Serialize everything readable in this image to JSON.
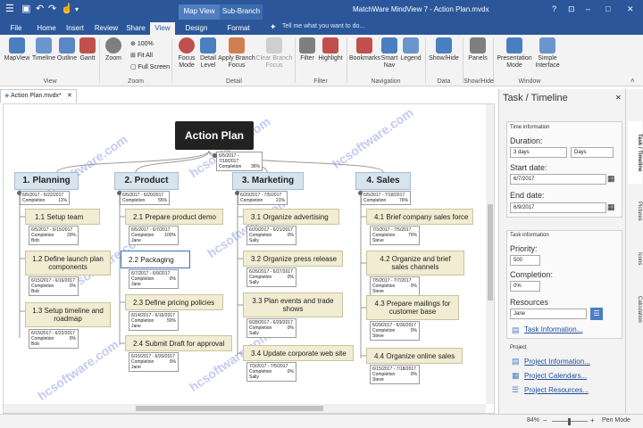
{
  "window": {
    "title": "MatchWare MindView 7 - Action Plan.mvdx",
    "minimize": "–",
    "maximize": "□",
    "close": "✕",
    "help": "?",
    "ribbon_toggle": "⊡"
  },
  "contextual": {
    "map_view": "Map View",
    "sub_branch": "Sub-Branch"
  },
  "menu_tabs": [
    "File",
    "Home",
    "Insert",
    "Review",
    "Share",
    "View",
    "Design",
    "Format"
  ],
  "active_tab": "View",
  "search": {
    "placeholder": "Tell me what you want to do..."
  },
  "ribbon": {
    "buttons": [
      "MapView",
      "Timeline",
      "Outline",
      "Gantt",
      "Zoom",
      "Focus Mode",
      "Detail Level",
      "Apply Branch Focus",
      "Clear Branch Focus",
      "Filter",
      "Highlight",
      "Bookmarks",
      "Smart Nav",
      "Legend",
      "Show/Hide",
      "Panels",
      "Presentation Mode",
      "Simple Interface"
    ],
    "zoom_small": [
      "100%",
      "Fit All",
      "Full Screen"
    ],
    "groups": [
      "View",
      "Zoom",
      "Detail",
      "Filter",
      "Navigation",
      "Data",
      "Show/Hide",
      "Window"
    ],
    "colors": {
      "accent": "#2b579a",
      "icon_blue": "#4a7fc1",
      "icon_red": "#c0504d",
      "icon_gray": "#7f7f7f"
    }
  },
  "doc_tab": {
    "label": "Action Plan.mvdx*",
    "close": "✕"
  },
  "map": {
    "root": {
      "label": "Action Plan",
      "dates": "6/5/2017 - 7/18/2017",
      "completion": "Completion",
      "percent": "36%"
    },
    "branches": [
      {
        "label": "1.  Planning",
        "dates": "6/5/2017 - 6/22/2017",
        "percent": "11%",
        "children": [
          {
            "label": "1.1  Setup team",
            "dates": "6/5/2017 - 6/15/2017",
            "percent": "20%",
            "owner": "Bob"
          },
          {
            "label": "1.2  Define launch plan components",
            "dates": "6/15/2017 - 6/16/2017",
            "percent": "0%",
            "owner": "Bob"
          },
          {
            "label": "1.3  Setup timeline and roadmap",
            "dates": "6/15/2017 - 6/22/2017",
            "percent": "0%",
            "owner": "Bob"
          }
        ]
      },
      {
        "label": "2.  Product",
        "dates": "6/5/2017 - 6/20/2017",
        "percent": "55%",
        "children": [
          {
            "label": "2.1  Prepare product demo",
            "dates": "6/5/2017 - 6/7/2017",
            "percent": "100%",
            "owner": "Jane"
          },
          {
            "label": "2.2  Packaging",
            "dates": "6/7/2017 - 6/9/2017",
            "percent": "0%",
            "owner": "Jane"
          },
          {
            "label": "2.3  Define pricing policies",
            "dates": "6/14/2017 - 6/16/2017",
            "percent": "50%",
            "owner": "Jane"
          },
          {
            "label": "2.4  Submit Draft for approval",
            "dates": "6/16/2017 - 6/20/2017",
            "percent": "0%",
            "owner": "Jane"
          }
        ]
      },
      {
        "label": "3.  Marketing",
        "dates": "6/20/2017 - 7/5/2017",
        "percent": "21%",
        "children": [
          {
            "label": "3.1  Organize advertising",
            "dates": "6/20/2017 - 6/21/2017",
            "percent": "0%",
            "owner": "Sally"
          },
          {
            "label": "3.2  Organize press release",
            "dates": "6/26/2017 - 6/27/2017",
            "percent": "0%",
            "owner": "Sally"
          },
          {
            "label": "3.3  Plan events and trade shows",
            "dates": "6/28/2017 - 6/29/2017",
            "percent": "0%",
            "owner": "Sally"
          },
          {
            "label": "3.4  Update corporate web site",
            "dates": "7/3/2017 - 7/5/2017",
            "percent": "0%",
            "owner": "Sally"
          }
        ]
      },
      {
        "label": "4.  Sales",
        "dates": "6/5/2017 - 7/18/2017",
        "percent": "76%",
        "children": [
          {
            "label": "4.1  Brief company sales force",
            "dates": "7/3/2017 - 7/5/2017",
            "percent": "70%",
            "owner": "Steve"
          },
          {
            "label": "4.2  Organize and brief sales channels",
            "dates": "7/5/2017 - 7/7/2017",
            "percent": "0%",
            "owner": "Steve"
          },
          {
            "label": "4.3  Prepare mailings for customer base",
            "dates": "6/29/2017 - 6/30/2017",
            "percent": "0%",
            "owner": "Steve"
          },
          {
            "label": "4.4  Organize online sales",
            "dates": "6/15/2017 - 7/18/2017",
            "percent": "0%",
            "owner": "Steve"
          }
        ]
      }
    ],
    "completion_label": "Completion"
  },
  "panel": {
    "title": "Task / Timeline",
    "close": "✕",
    "time_info": "Time information",
    "duration_label": "Duration:",
    "duration_value": "3 days",
    "duration_unit": "Days",
    "start_label": "Start date:",
    "start_value": "6/7/2017",
    "end_label": "End date:",
    "end_value": "6/9/2017",
    "task_info": "Task information",
    "priority_label": "Priority:",
    "priority_value": "500",
    "completion_label": "Completion:",
    "completion_value": "0%",
    "resources_label": "Resources",
    "resources_value": "Jane",
    "task_info_link": "Task Information...",
    "project": "Project",
    "project_links": [
      "Project Information...",
      "Project Calendars...",
      "Project Resources..."
    ]
  },
  "side_tabs": [
    "Task / Timeline",
    "Pictures",
    "Icons",
    "Calculation"
  ],
  "status": {
    "zoom": "84%",
    "minus": "−",
    "plus": "+",
    "mode": "Pen Mode"
  },
  "watermark": "hcsoftware.com"
}
